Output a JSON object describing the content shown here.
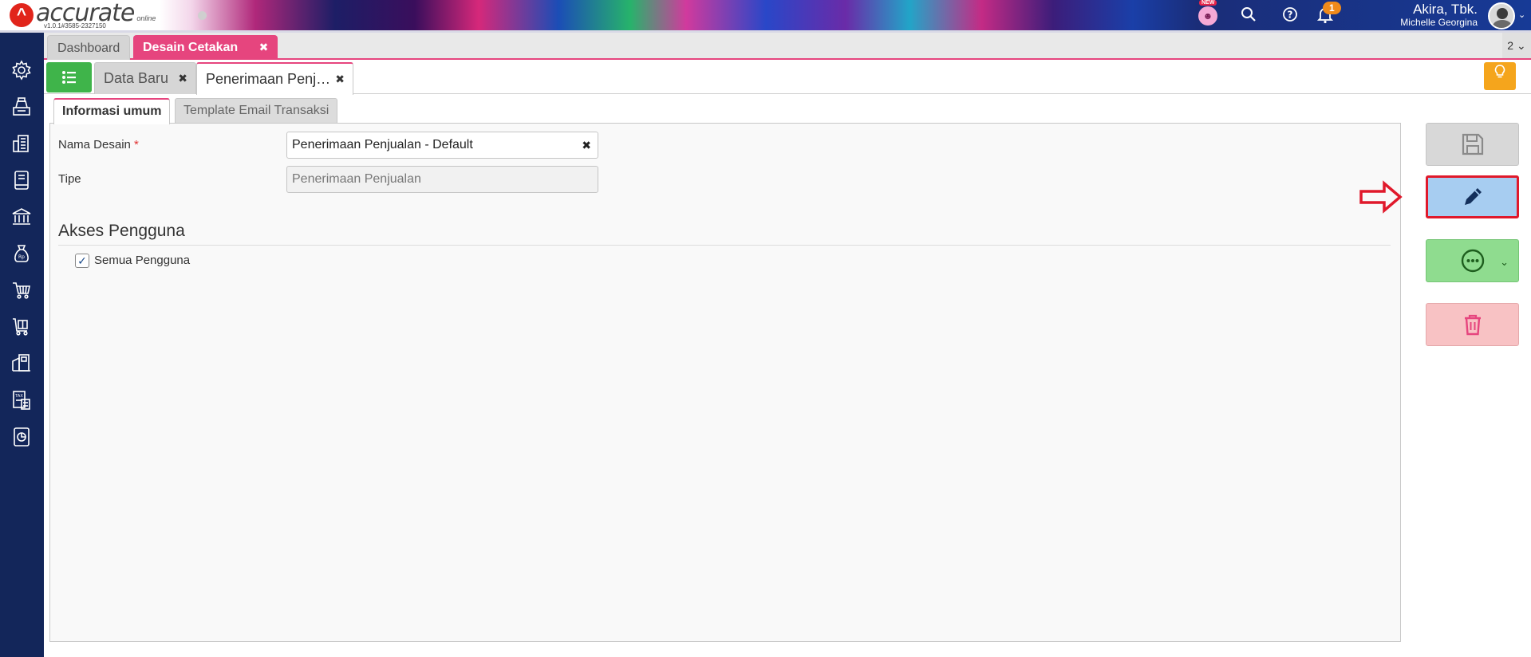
{
  "header": {
    "logo_text": "accurate",
    "logo_cloud": "online",
    "version": "v1.0.1#3585-2327150",
    "new_badge": "NEW",
    "notification_count": "1",
    "company": "Akira, Tbk.",
    "user": "Michelle Georgina"
  },
  "module_tabs": {
    "dashboard": "Dashboard",
    "desain": "Desain Cetakan",
    "page_count": "2"
  },
  "sub_tabs": {
    "data_baru": "Data Baru",
    "penerimaan": "Penerimaan Penj…"
  },
  "form_tabs": {
    "info": "Informasi umum",
    "email": "Template Email Transaksi"
  },
  "form": {
    "nama_label": "Nama Desain",
    "required_mark": "*",
    "nama_value": "Penerimaan Penjualan - Default",
    "tipe_label": "Tipe",
    "tipe_value": "Penerimaan Penjualan",
    "section_title": "Akses Pengguna",
    "all_users_label": "Semua Pengguna",
    "all_users_checked": true
  },
  "colors": {
    "accent": "#e6457e",
    "sidebar": "#13265a",
    "edit_button": "#a7cdf1",
    "more_button": "#8fdc8f",
    "delete_button": "#f8c2c4",
    "highlight": "#e0192b"
  }
}
